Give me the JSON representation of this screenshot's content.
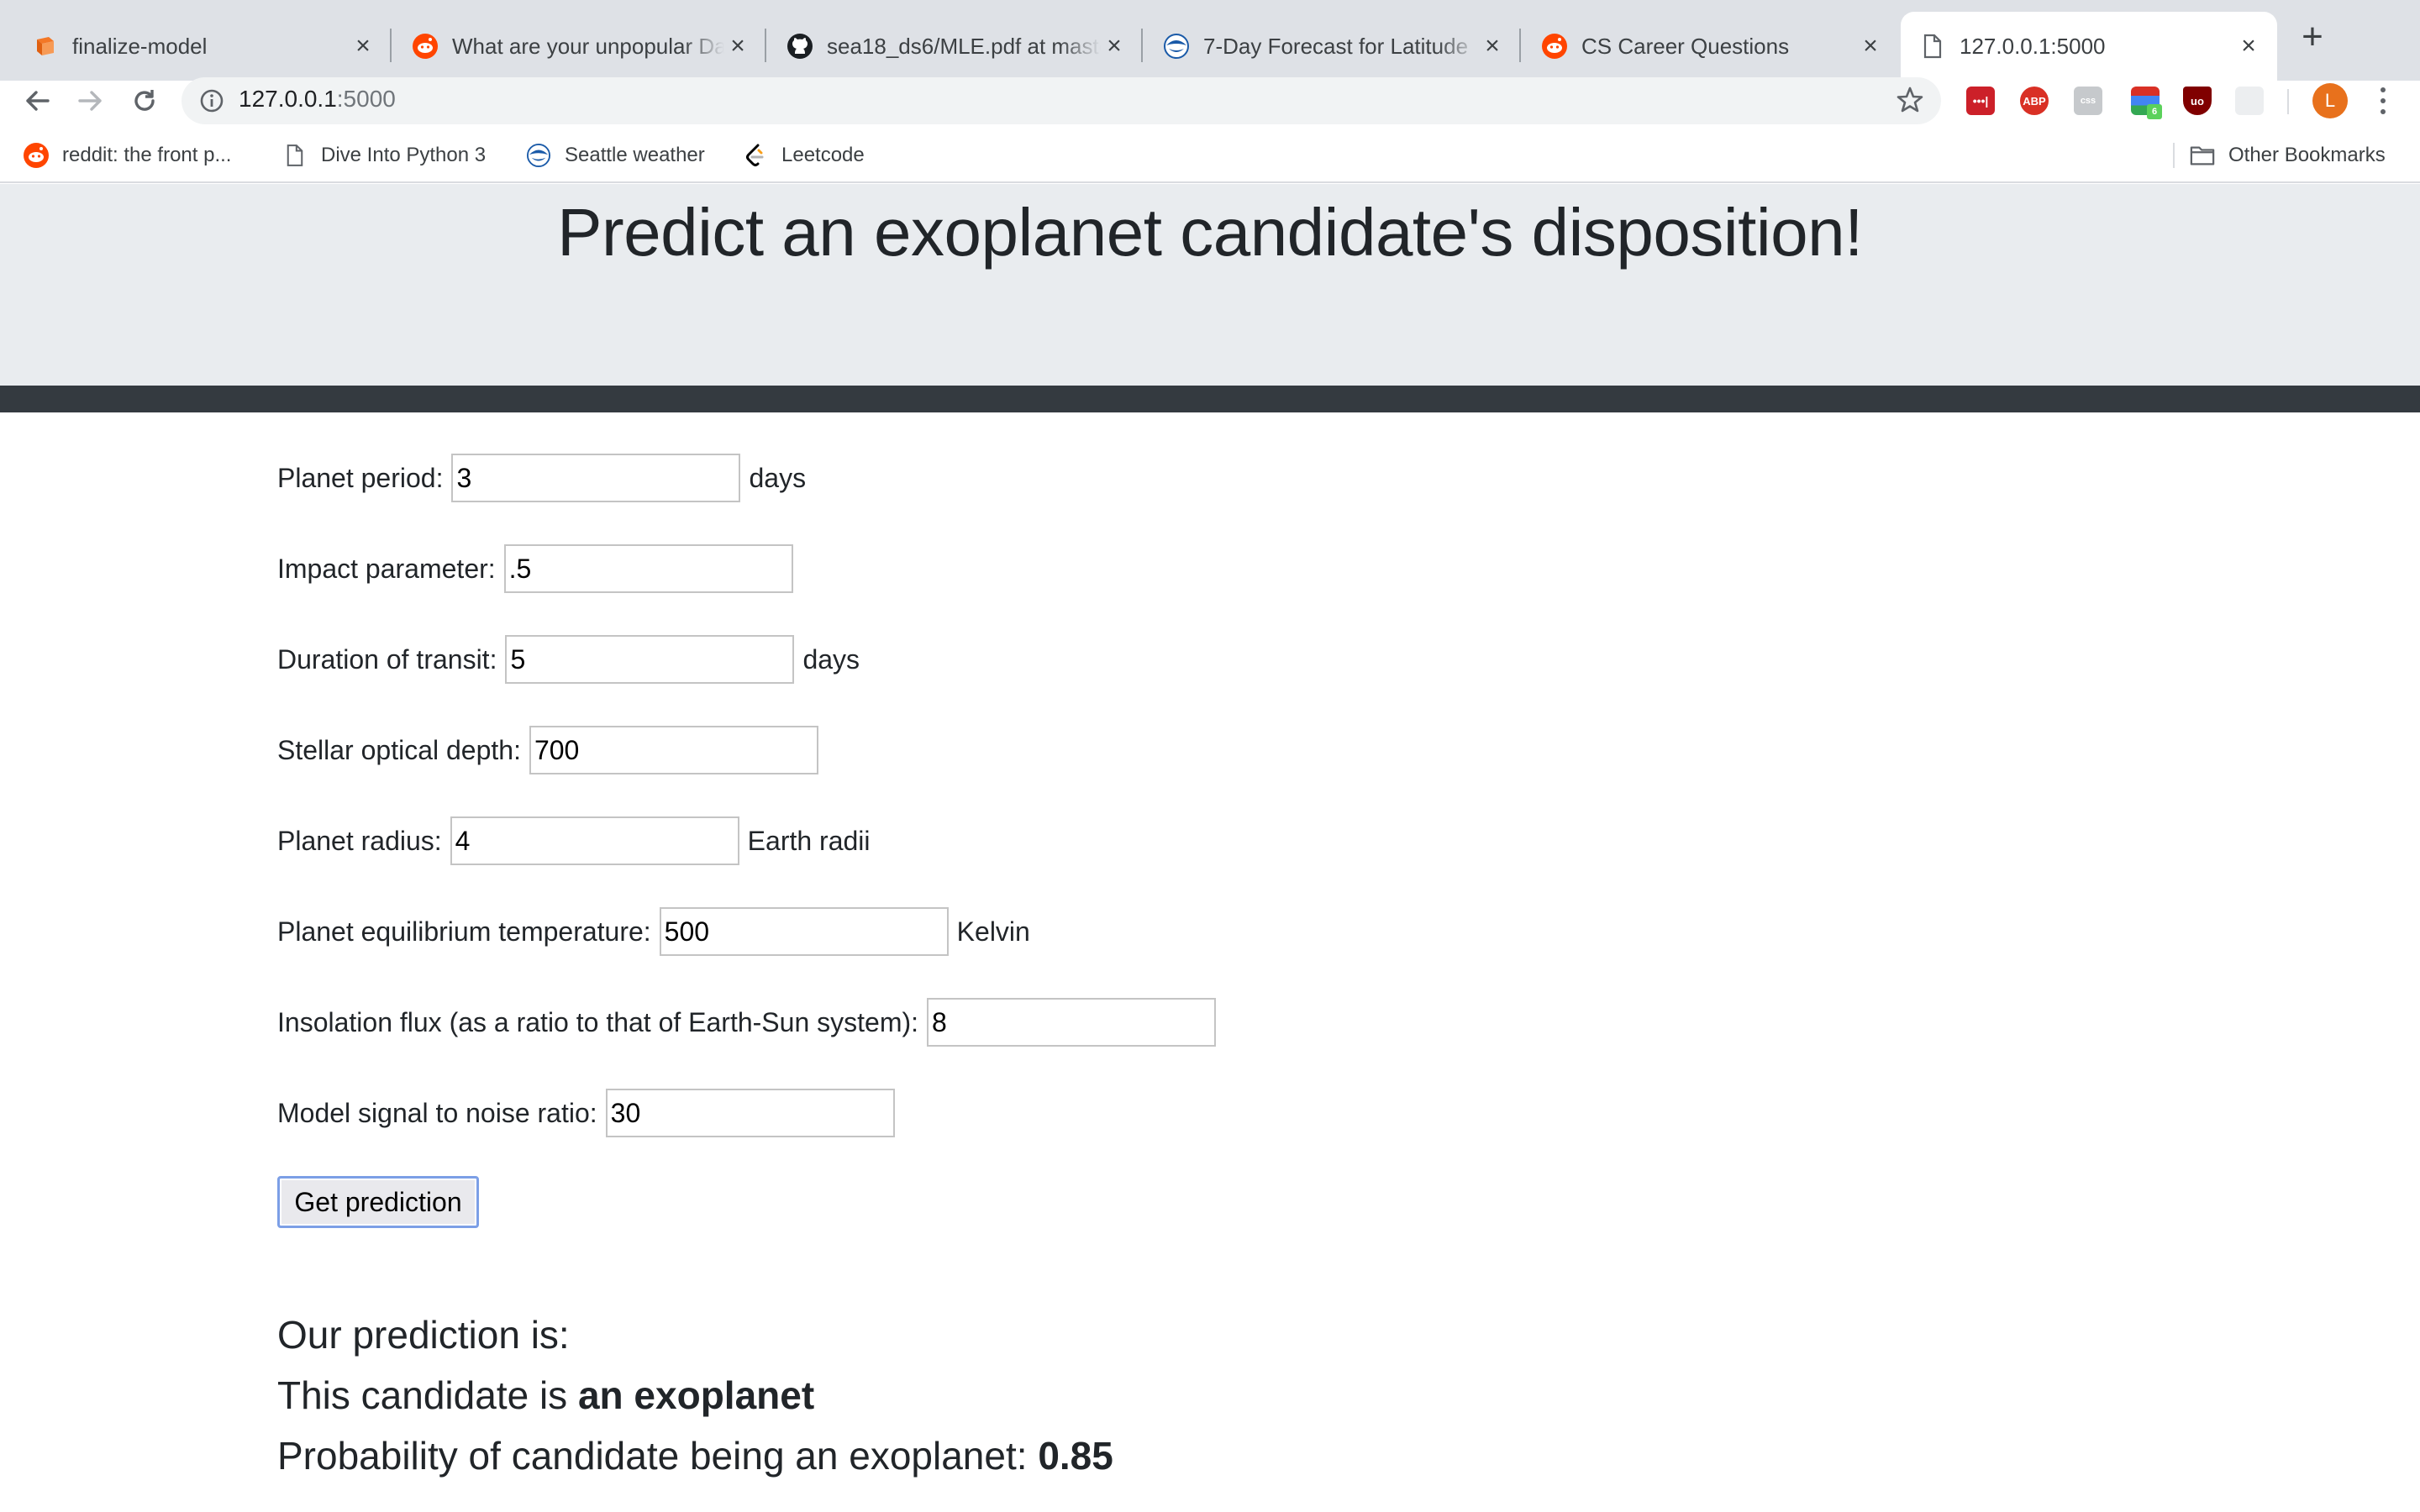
{
  "browser": {
    "tabs": [
      {
        "title": "finalize-model",
        "icon": "jupyter-book-icon",
        "active": false
      },
      {
        "title": "What are your unpopular Data",
        "icon": "reddit-icon",
        "active": false
      },
      {
        "title": "sea18_ds6/MLE.pdf at master",
        "icon": "github-icon",
        "active": false
      },
      {
        "title": "7-Day Forecast for Latitude",
        "icon": "noaa-icon",
        "active": false
      },
      {
        "title": "CS Career Questions",
        "icon": "reddit-icon",
        "active": false
      },
      {
        "title": "127.0.0.1:5000",
        "icon": "page-icon",
        "active": true
      }
    ],
    "address": {
      "host": "127.0.0.1",
      "port": ":5000"
    },
    "bookmarks": [
      {
        "label": "reddit: the front p...",
        "icon": "reddit-icon"
      },
      {
        "label": "Dive Into Python 3",
        "icon": "page-icon"
      },
      {
        "label": "Seattle weather",
        "icon": "noaa-icon"
      },
      {
        "label": "Leetcode",
        "icon": "leetcode-icon"
      }
    ],
    "other_bookmarks": "Other Bookmarks",
    "profile_initial": "L",
    "extensions": [
      "lastpass",
      "adblock-plus",
      "css-viewer",
      "color-extension",
      "ublock-origin",
      "ext-disabled"
    ],
    "colors": {
      "accent_reddit": "#ff4500",
      "profile": "#e8711c"
    }
  },
  "page": {
    "title": "Predict an exoplanet candidate's disposition!",
    "fields": [
      {
        "label": "Planet period:",
        "value": "3",
        "unit": "days"
      },
      {
        "label": "Impact parameter:",
        "value": ".5",
        "unit": ""
      },
      {
        "label": "Duration of transit:",
        "value": "5",
        "unit": "days"
      },
      {
        "label": "Stellar optical depth:",
        "value": "700",
        "unit": ""
      },
      {
        "label": "Planet radius:",
        "value": "4",
        "unit": "Earth radii"
      },
      {
        "label": "Planet equilibrium temperature:",
        "value": "500",
        "unit": "Kelvin"
      },
      {
        "label": "Insolation flux (as a ratio to that of Earth-Sun system):",
        "value": "8",
        "unit": ""
      },
      {
        "label": "Model signal to noise ratio:",
        "value": "30",
        "unit": ""
      }
    ],
    "submit_label": "Get prediction",
    "result": {
      "heading": "Our prediction is:",
      "verdict_prefix": "This candidate is ",
      "verdict": "an exoplanet",
      "probability_prefix": "Probability of candidate being an exoplanet: ",
      "probability": "0.85"
    }
  }
}
